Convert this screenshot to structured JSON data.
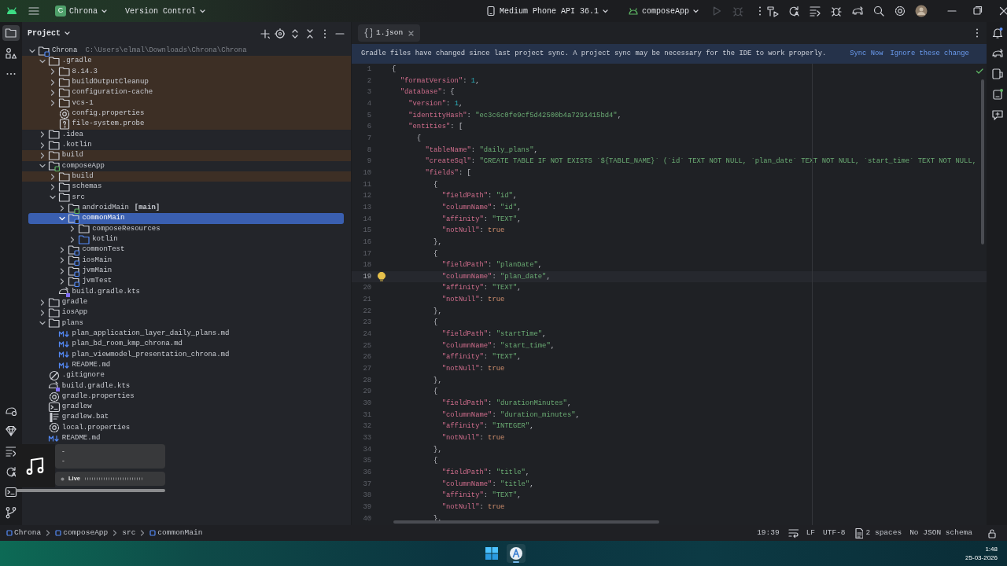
{
  "title_bar": {
    "project": {
      "badge": "C",
      "name": "Chrona"
    },
    "vcs": "Version Control",
    "device": "Medium Phone API 36.1",
    "run_config": "composeApp"
  },
  "project_panel": {
    "title": "Project",
    "tree": [
      {
        "name": "Chrona",
        "path": "C:\\Users\\elmal\\Downloads\\Chrona\\Chrona",
        "kind": "module",
        "expanded": true,
        "selected": false,
        "excluded": false,
        "children": [
          {
            "name": ".gradle",
            "kind": "folder",
            "expanded": true,
            "selected": false,
            "excluded": true,
            "children": [
              {
                "name": "8.14.3",
                "kind": "folder",
                "expanded": false,
                "selected": false,
                "excluded": true
              },
              {
                "name": "buildOutputCleanup",
                "kind": "folder",
                "expanded": false,
                "selected": false,
                "excluded": true
              },
              {
                "name": "configuration-cache",
                "kind": "folder",
                "expanded": false,
                "selected": false,
                "excluded": true
              },
              {
                "name": "vcs-1",
                "kind": "folder",
                "expanded": false,
                "selected": false,
                "excluded": true
              },
              {
                "name": "config.properties",
                "kind": "settings",
                "selected": false,
                "excluded": true
              },
              {
                "name": "file-system.probe",
                "kind": "unknown",
                "selected": false,
                "excluded": true
              }
            ]
          },
          {
            "name": ".idea",
            "kind": "folder",
            "expanded": false,
            "selected": false,
            "excluded": false
          },
          {
            "name": ".kotlin",
            "kind": "folder",
            "expanded": false,
            "selected": false,
            "excluded": false
          },
          {
            "name": "build",
            "kind": "folder",
            "expanded": false,
            "selected": false,
            "excluded": true
          },
          {
            "name": "composeApp",
            "kind": "app",
            "expanded": true,
            "selected": false,
            "excluded": false,
            "children": [
              {
                "name": "build",
                "kind": "folder",
                "expanded": false,
                "selected": false,
                "excluded": true
              },
              {
                "name": "schemas",
                "kind": "folder",
                "expanded": false,
                "selected": false,
                "excluded": false
              },
              {
                "name": "src",
                "kind": "folder",
                "expanded": true,
                "selected": false,
                "excluded": false,
                "children": [
                  {
                    "name": "androidMain",
                    "tag": "[main]",
                    "kind": "app",
                    "expanded": false,
                    "selected": false,
                    "excluded": false
                  },
                  {
                    "name": "commonMain",
                    "kind": "module",
                    "expanded": true,
                    "selected": true,
                    "excluded": false,
                    "children": [
                      {
                        "name": "composeResources",
                        "kind": "folder",
                        "expanded": false,
                        "selected": false,
                        "excluded": false
                      },
                      {
                        "name": "kotlin",
                        "kind": "source",
                        "expanded": false,
                        "selected": false,
                        "excluded": false
                      }
                    ]
                  },
                  {
                    "name": "commonTest",
                    "kind": "module",
                    "expanded": false,
                    "selected": false,
                    "excluded": false
                  },
                  {
                    "name": "iosMain",
                    "kind": "module",
                    "expanded": false,
                    "selected": false,
                    "excluded": false
                  },
                  {
                    "name": "jvmMain",
                    "kind": "module",
                    "expanded": false,
                    "selected": false,
                    "excluded": false
                  },
                  {
                    "name": "jvmTest",
                    "kind": "module",
                    "expanded": false,
                    "selected": false,
                    "excluded": false
                  }
                ]
              },
              {
                "name": "build.gradle.kts",
                "kind": "gradle",
                "selected": false,
                "excluded": false
              }
            ]
          },
          {
            "name": "gradle",
            "kind": "folder",
            "expanded": false,
            "selected": false,
            "excluded": false
          },
          {
            "name": "iosApp",
            "kind": "folder",
            "expanded": false,
            "selected": false,
            "excluded": false
          },
          {
            "name": "plans",
            "kind": "folder",
            "expanded": true,
            "selected": false,
            "excluded": false,
            "children": [
              {
                "name": "plan_application_layer_daily_plans.md",
                "kind": "markdown",
                "selected": false,
                "excluded": false
              },
              {
                "name": "plan_bd_room_kmp_chrona.md",
                "kind": "markdown",
                "selected": false,
                "excluded": false
              },
              {
                "name": "plan_viewmodel_presentation_chrona.md",
                "kind": "markdown",
                "selected": false,
                "excluded": false
              },
              {
                "name": "README.md",
                "kind": "markdown",
                "selected": false,
                "excluded": false
              }
            ]
          },
          {
            "name": ".gitignore",
            "kind": "ignore",
            "selected": false,
            "excluded": false
          },
          {
            "name": "build.gradle.kts",
            "kind": "gradle",
            "selected": false,
            "excluded": false
          },
          {
            "name": "gradle.properties",
            "kind": "settings",
            "selected": false,
            "excluded": false
          },
          {
            "name": "gradlew",
            "kind": "terminal",
            "selected": false,
            "excluded": false
          },
          {
            "name": "gradlew.bat",
            "kind": "batch",
            "selected": false,
            "excluded": false
          },
          {
            "name": "local.properties",
            "kind": "settings",
            "selected": false,
            "excluded": false
          },
          {
            "name": "README.md",
            "kind": "markdown",
            "selected": false,
            "excluded": false
          }
        ]
      }
    ]
  },
  "editor": {
    "tabs": [
      {
        "label": "1.json",
        "selected": true
      }
    ],
    "banner": {
      "message": "Gradle files have changed since last project sync. A project sync may be necessary for the IDE to work properly.",
      "actions": [
        "Sync Now",
        "Ignore these change"
      ]
    },
    "lines": [
      {
        "number": "1",
        "text": "{",
        "current": false
      },
      {
        "number": "2",
        "text": "  \"formatVersion\": 1,",
        "current": false
      },
      {
        "number": "3",
        "text": "  \"database\": {",
        "current": false
      },
      {
        "number": "4",
        "text": "    \"version\": 1,",
        "current": false
      },
      {
        "number": "5",
        "text": "    \"identityHash\": \"ec3c6c0fe9cf5d42500b4a7291415bd4\",",
        "current": false
      },
      {
        "number": "6",
        "text": "    \"entities\": [",
        "current": false
      },
      {
        "number": "7",
        "text": "      {",
        "current": false
      },
      {
        "number": "8",
        "text": "        \"tableName\": \"daily_plans\",",
        "current": false
      },
      {
        "number": "9",
        "text": "        \"createSql\": \"CREATE TABLE IF NOT EXISTS `${TABLE_NAME}` (`id` TEXT NOT NULL, `plan_date` TEXT NOT NULL, `start_time` TEXT NOT NULL,",
        "current": false
      },
      {
        "number": "10",
        "text": "        \"fields\": [",
        "current": false
      },
      {
        "number": "11",
        "text": "          {",
        "current": false
      },
      {
        "number": "12",
        "text": "            \"fieldPath\": \"id\",",
        "current": false
      },
      {
        "number": "13",
        "text": "            \"columnName\": \"id\",",
        "current": false
      },
      {
        "number": "14",
        "text": "            \"affinity\": \"TEXT\",",
        "current": false
      },
      {
        "number": "15",
        "text": "            \"notNull\": true",
        "current": false
      },
      {
        "number": "16",
        "text": "          },",
        "current": false
      },
      {
        "number": "17",
        "text": "          {",
        "current": false
      },
      {
        "number": "18",
        "text": "            \"fieldPath\": \"planDate\",",
        "current": false
      },
      {
        "number": "19",
        "text": "            \"columnName\": \"plan_date\",",
        "current": true
      },
      {
        "number": "20",
        "text": "            \"affinity\": \"TEXT\",",
        "current": false
      },
      {
        "number": "21",
        "text": "            \"notNull\": true",
        "current": false
      },
      {
        "number": "22",
        "text": "          },",
        "current": false
      },
      {
        "number": "23",
        "text": "          {",
        "current": false
      },
      {
        "number": "24",
        "text": "            \"fieldPath\": \"startTime\",",
        "current": false
      },
      {
        "number": "25",
        "text": "            \"columnName\": \"start_time\",",
        "current": false
      },
      {
        "number": "26",
        "text": "            \"affinity\": \"TEXT\",",
        "current": false
      },
      {
        "number": "27",
        "text": "            \"notNull\": true",
        "current": false
      },
      {
        "number": "28",
        "text": "          },",
        "current": false
      },
      {
        "number": "29",
        "text": "          {",
        "current": false
      },
      {
        "number": "30",
        "text": "            \"fieldPath\": \"durationMinutes\",",
        "current": false
      },
      {
        "number": "31",
        "text": "            \"columnName\": \"duration_minutes\",",
        "current": false
      },
      {
        "number": "32",
        "text": "            \"affinity\": \"INTEGER\",",
        "current": false
      },
      {
        "number": "33",
        "text": "            \"notNull\": true",
        "current": false
      },
      {
        "number": "34",
        "text": "          },",
        "current": false
      },
      {
        "number": "35",
        "text": "          {",
        "current": false
      },
      {
        "number": "36",
        "text": "            \"fieldPath\": \"title\",",
        "current": false
      },
      {
        "number": "37",
        "text": "            \"columnName\": \"title\",",
        "current": false
      },
      {
        "number": "38",
        "text": "            \"affinity\": \"TEXT\",",
        "current": false
      },
      {
        "number": "39",
        "text": "            \"notNull\": true",
        "current": false
      },
      {
        "number": "40",
        "text": "          },",
        "current": false
      }
    ]
  },
  "media_overlay": {
    "lines": [
      "-",
      "-"
    ],
    "badge": "Live"
  },
  "status_bar": {
    "breadcrumbs": [
      {
        "label": "Chrona",
        "kind": "module"
      },
      {
        "label": "composeApp",
        "kind": "module"
      },
      {
        "label": "src",
        "kind": "plain"
      },
      {
        "label": "commonMain",
        "kind": "module"
      }
    ],
    "caret": "19:39",
    "line_separator": "LF",
    "encoding": "UTF-8",
    "indent": "2 spaces",
    "schema": "No JSON schema"
  },
  "taskbar": {
    "time": "1:48",
    "date": "25-03-2026"
  }
}
